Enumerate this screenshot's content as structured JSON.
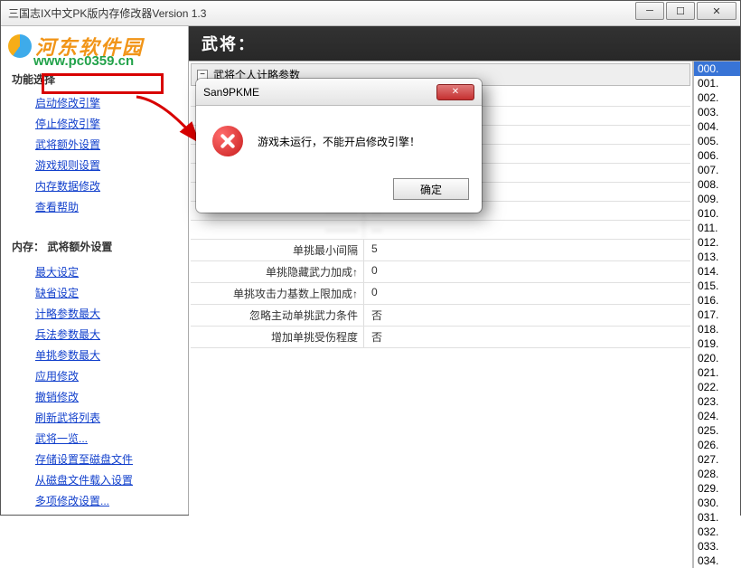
{
  "window": {
    "title": "三国志IX中文PK版内存修改器Version 1.3"
  },
  "watermark": {
    "brand": "河东软件园",
    "url": "www.pc0359.cn"
  },
  "left": {
    "section1_label": "功能选择",
    "menu1": [
      "启动修改引擎",
      "停止修改引擎",
      "武将额外设置",
      "游戏规则设置",
      "内存数据修改",
      "查看帮助"
    ],
    "section2_label": "内存： 武将额外设置",
    "menu2": [
      "最大设定",
      "缺省设定",
      "计略参数最大",
      "兵法参数最大",
      "单挑参数最大",
      "应用修改",
      "撤销修改",
      "刷新武将列表",
      "武将一览...",
      "存储设置至磁盘文件",
      "从磁盘文件载入设置",
      "多项修改设置..."
    ]
  },
  "right": {
    "header": "武将：",
    "group_title": "武将个人计略参数",
    "rows": [
      {
        "label": "单挑最小间隔",
        "value": "5"
      },
      {
        "label": "单挑隐藏武力加成↑",
        "value": "0"
      },
      {
        "label": "单挑攻击力基数上限加成↑",
        "value": "0"
      },
      {
        "label": "忽略主动单挑武力条件",
        "value": "否"
      },
      {
        "label": "增加单挑受伤程度",
        "value": "否"
      }
    ],
    "blurred_rows_count": 8,
    "number_list_max": 34,
    "number_selected": 0
  },
  "dialog": {
    "title": "San9PKME",
    "message": "游戏未运行，不能开启修改引擎！",
    "ok": "确定"
  }
}
